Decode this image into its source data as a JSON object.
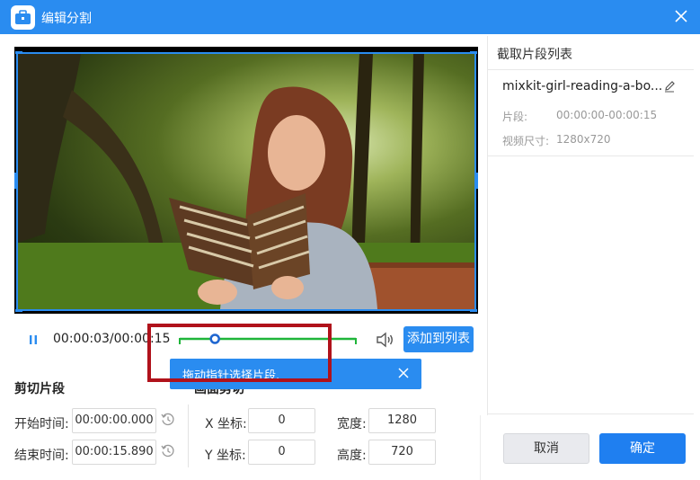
{
  "window": {
    "title": "编辑分割",
    "accent_color": "#2a8cf0"
  },
  "player": {
    "time_display": "00:00:03/00:00:15",
    "progress_fraction": 0.2,
    "add_to_list_label": "添加到列表",
    "tooltip_text": "拖动指针选择片段."
  },
  "cut_segment": {
    "title": "剪切片段",
    "start_label": "开始时间:",
    "start_value": "00:00:00.000",
    "end_label": "结束时间:",
    "end_value": "00:00:15.890"
  },
  "crop": {
    "title": "画面剪切",
    "x_label": "X 坐标:",
    "x_value": "0",
    "y_label": "Y 坐标:",
    "y_value": "0",
    "width_label": "宽度:",
    "width_value": "1280",
    "height_label": "高度:",
    "height_value": "720"
  },
  "segment_list": {
    "title": "截取片段列表",
    "items": [
      {
        "name": "mixkit-girl-reading-a-bo...",
        "segment_label": "片段:",
        "segment_value": "00:00:00-00:00:15",
        "size_label": "视频尺寸:",
        "size_value": "1280x720"
      }
    ]
  },
  "footer": {
    "cancel_label": "取消",
    "ok_label": "确定"
  }
}
